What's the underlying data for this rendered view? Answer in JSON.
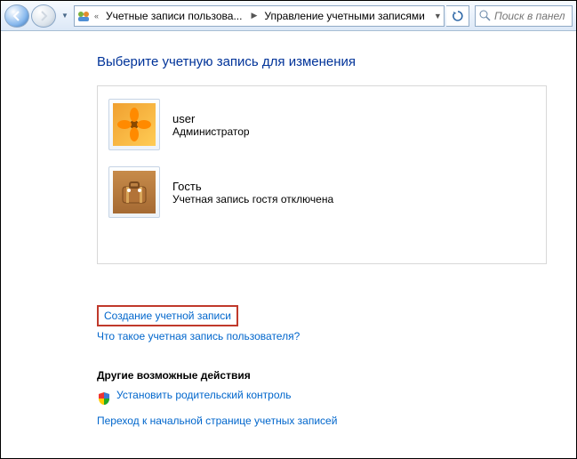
{
  "nav": {
    "breadcrumb_prefix": "«",
    "crumb1": "Учетные записи пользова...",
    "crumb2": "Управление учетными записями",
    "search_placeholder": "Поиск в панели"
  },
  "heading": "Выберите учетную запись для изменения",
  "accounts": [
    {
      "name": "user",
      "desc": "Администратор"
    },
    {
      "name": "Гость",
      "desc": "Учетная запись гостя отключена"
    }
  ],
  "links": {
    "create": "Создание учетной записи",
    "what_is": "Что такое учетная запись пользователя?"
  },
  "other": {
    "heading": "Другие возможные действия",
    "parental": "Установить родительский контроль",
    "goto_main": "Переход к начальной странице учетных записей"
  }
}
